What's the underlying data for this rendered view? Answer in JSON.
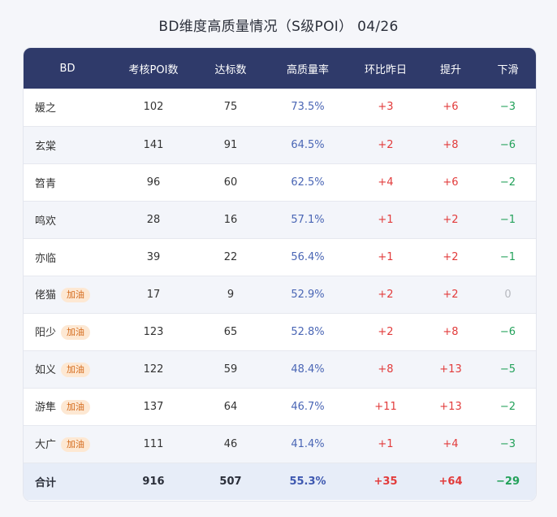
{
  "title": "BD维度高质量情况（S级POI） 04/26",
  "table": {
    "headers": [
      "BD",
      "考核POI数",
      "达标数",
      "高质量率",
      "环比昨日",
      "提升",
      "下滑"
    ],
    "rows": [
      {
        "name": "媛之",
        "tag": "",
        "poi": "102",
        "pass": "75",
        "rate": "73.5%",
        "dod": "+3",
        "up": "+6",
        "down": "−3"
      },
      {
        "name": "玄棠",
        "tag": "",
        "poi": "141",
        "pass": "91",
        "rate": "64.5%",
        "dod": "+2",
        "up": "+8",
        "down": "−6"
      },
      {
        "name": "笤青",
        "tag": "",
        "poi": "96",
        "pass": "60",
        "rate": "62.5%",
        "dod": "+4",
        "up": "+6",
        "down": "−2"
      },
      {
        "name": "鸣欢",
        "tag": "",
        "poi": "28",
        "pass": "16",
        "rate": "57.1%",
        "dod": "+1",
        "up": "+2",
        "down": "−1"
      },
      {
        "name": "亦临",
        "tag": "",
        "poi": "39",
        "pass": "22",
        "rate": "56.4%",
        "dod": "+1",
        "up": "+2",
        "down": "−1"
      },
      {
        "name": "佬猫",
        "tag": "加油",
        "poi": "17",
        "pass": "9",
        "rate": "52.9%",
        "dod": "+2",
        "up": "+2",
        "down": "0"
      },
      {
        "name": "阳少",
        "tag": "加油",
        "poi": "123",
        "pass": "65",
        "rate": "52.8%",
        "dod": "+2",
        "up": "+8",
        "down": "−6"
      },
      {
        "name": "如义",
        "tag": "加油",
        "poi": "122",
        "pass": "59",
        "rate": "48.4%",
        "dod": "+8",
        "up": "+13",
        "down": "−5"
      },
      {
        "name": "游隼",
        "tag": "加油",
        "poi": "137",
        "pass": "64",
        "rate": "46.7%",
        "dod": "+11",
        "up": "+13",
        "down": "−2"
      },
      {
        "name": "大广",
        "tag": "加油",
        "poi": "111",
        "pass": "46",
        "rate": "41.4%",
        "dod": "+1",
        "up": "+4",
        "down": "−3"
      }
    ],
    "total": {
      "name": "合计",
      "poi": "916",
      "pass": "507",
      "rate": "55.3%",
      "dod": "+35",
      "up": "+64",
      "down": "−29"
    }
  },
  "colors": {
    "header_bg": "#2f3a6a",
    "rate": "#4a66b5",
    "positive": "#e23b3b",
    "negative": "#23a15a",
    "tag_bg": "#fde8d3",
    "tag_text": "#d46a1b"
  }
}
